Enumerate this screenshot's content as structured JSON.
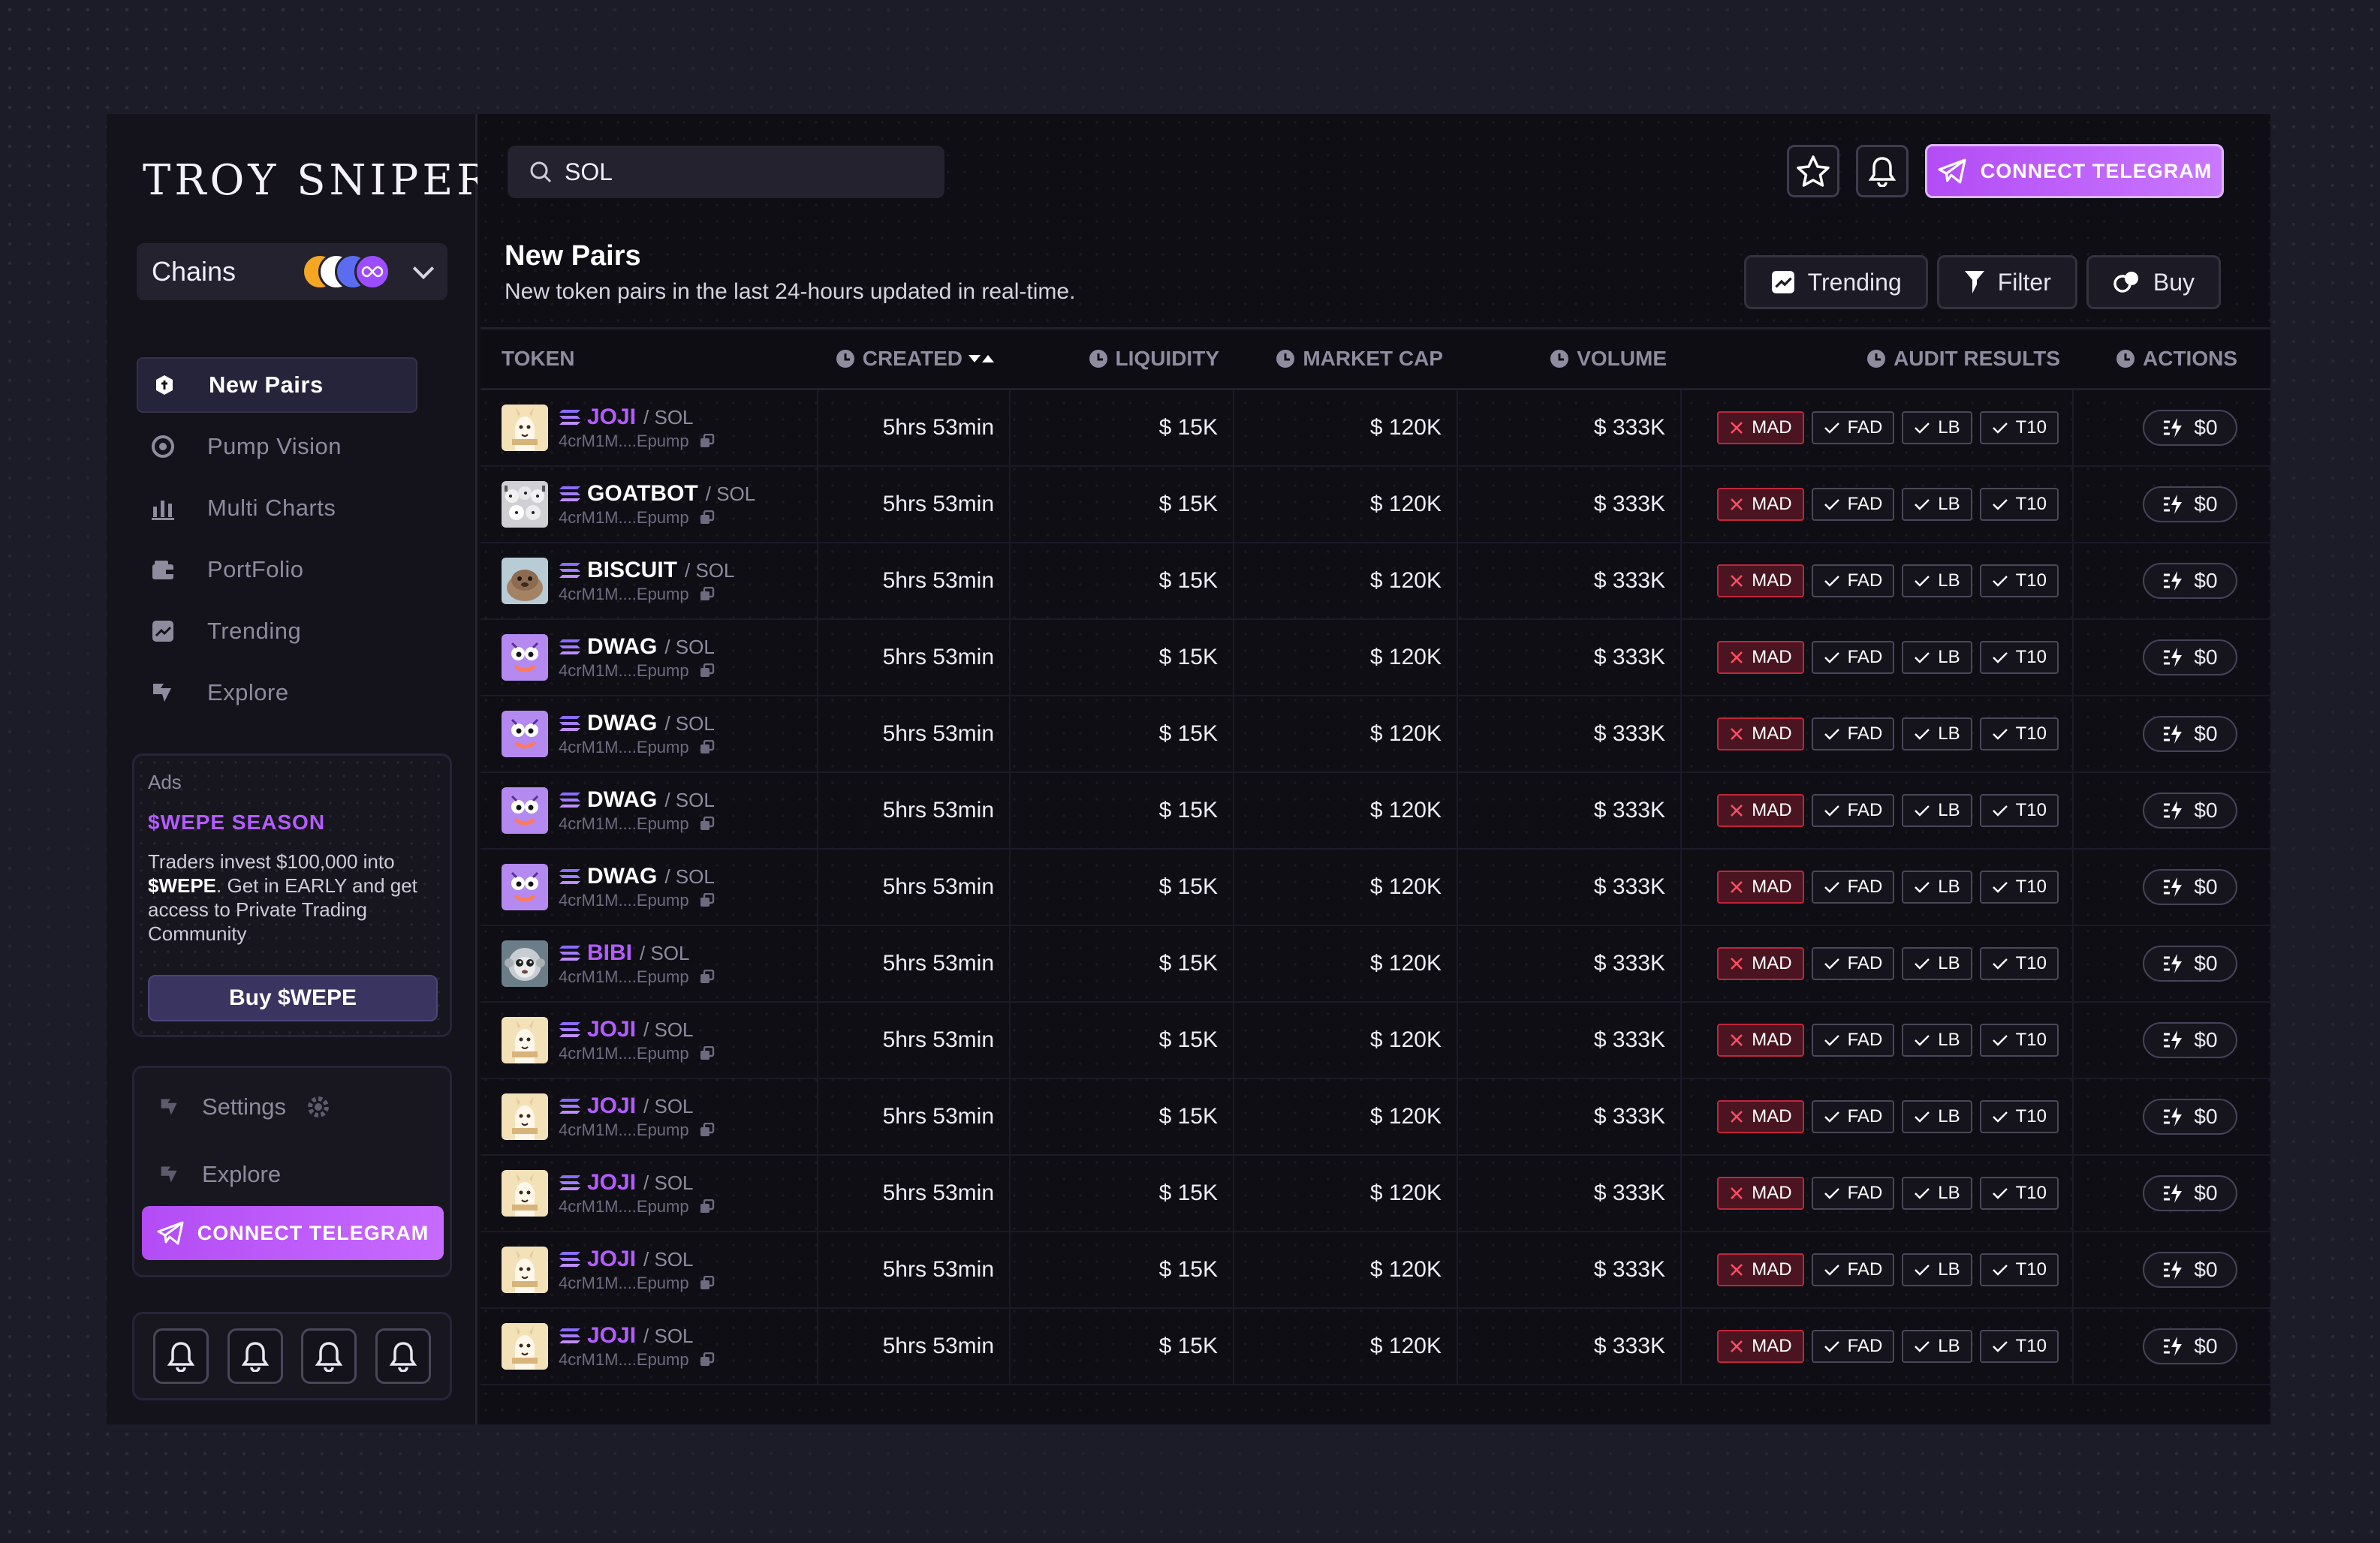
{
  "app": {
    "brand": "TROY SNIPER"
  },
  "chains": {
    "label": "Chains",
    "icon_colors": [
      "#f5a623",
      "#ffffff",
      "#5b6cf0",
      "#9b4dff"
    ]
  },
  "nav": {
    "items": [
      {
        "label": "New Pairs",
        "icon": "new-pairs-icon",
        "active": true
      },
      {
        "label": "Pump Vision",
        "icon": "pump-vision-icon"
      },
      {
        "label": "Multi Charts",
        "icon": "bar-chart-icon"
      },
      {
        "label": "PortFolio",
        "icon": "portfolio-icon"
      },
      {
        "label": "Trending",
        "icon": "trending-icon"
      },
      {
        "label": "Explore",
        "icon": "explore-icon"
      }
    ]
  },
  "ads": {
    "label": "Ads",
    "title": "$WEPE SEASON",
    "text_a": "Traders invest $100,000 into ",
    "text_b": "$WEPE",
    "text_c": ". Get in EARLY and get access to Private Trading Community",
    "button": "Buy $WEPE"
  },
  "bottom_menu": {
    "settings": "Settings",
    "explore": "Explore",
    "telegram": "CONNECT TELEGRAM"
  },
  "header": {
    "search_value": "SOL",
    "telegram_button": "CONNECT TELEGRAM"
  },
  "page": {
    "title": "New Pairs",
    "subtitle": "New token pairs in the last 24-hours updated in real-time.",
    "buttons": {
      "trending": "Trending",
      "filter": "Filter",
      "buy": "Buy"
    }
  },
  "table": {
    "headers": {
      "token": "TOKEN",
      "created": "CREATED",
      "liquidity": "LIQUIDITY",
      "market_cap": "MARKET CAP",
      "volume": "VOLUME",
      "audit": "AUDIT RESULTS",
      "actions": "ACTIONS"
    },
    "rows": [
      {
        "name": "JOJI",
        "pair": "/ SOL",
        "addr": "4crM1M....Epump",
        "created": "5hrs 53min",
        "liquidity": "$ 15K",
        "market_cap": "$ 120K",
        "volume": "$ 333K",
        "audits": [
          "MAD",
          "FAD",
          "LB",
          "T10"
        ],
        "action": "$0",
        "name_color": "#b45cff",
        "avatar": "llama"
      },
      {
        "name": "GOATBOT",
        "pair": "/ SOL",
        "addr": "4crM1M....Epump",
        "created": "5hrs 53min",
        "liquidity": "$ 15K",
        "market_cap": "$ 120K",
        "volume": "$ 333K",
        "audits": [
          "MAD",
          "FAD",
          "LB",
          "T10"
        ],
        "action": "$0",
        "name_color": "#ffffff",
        "avatar": "goat"
      },
      {
        "name": "BISCUIT",
        "pair": "/ SOL",
        "addr": "4crM1M....Epump",
        "created": "5hrs 53min",
        "liquidity": "$ 15K",
        "market_cap": "$ 120K",
        "volume": "$ 333K",
        "audits": [
          "MAD",
          "FAD",
          "LB",
          "T10"
        ],
        "action": "$0",
        "name_color": "#ffffff",
        "avatar": "biscuit"
      },
      {
        "name": "DWAG",
        "pair": "/ SOL",
        "addr": "4crM1M....Epump",
        "created": "5hrs 53min",
        "liquidity": "$ 15K",
        "market_cap": "$ 120K",
        "volume": "$ 333K",
        "audits": [
          "MAD",
          "FAD",
          "LB",
          "T10"
        ],
        "action": "$0",
        "name_color": "#ffffff",
        "avatar": "dwag"
      },
      {
        "name": "DWAG",
        "pair": "/ SOL",
        "addr": "4crM1M....Epump",
        "created": "5hrs 53min",
        "liquidity": "$ 15K",
        "market_cap": "$ 120K",
        "volume": "$ 333K",
        "audits": [
          "MAD",
          "FAD",
          "LB",
          "T10"
        ],
        "action": "$0",
        "name_color": "#ffffff",
        "avatar": "dwag"
      },
      {
        "name": "DWAG",
        "pair": "/ SOL",
        "addr": "4crM1M....Epump",
        "created": "5hrs 53min",
        "liquidity": "$ 15K",
        "market_cap": "$ 120K",
        "volume": "$ 333K",
        "audits": [
          "MAD",
          "FAD",
          "LB",
          "T10"
        ],
        "action": "$0",
        "name_color": "#ffffff",
        "avatar": "dwag"
      },
      {
        "name": "DWAG",
        "pair": "/ SOL",
        "addr": "4crM1M....Epump",
        "created": "5hrs 53min",
        "liquidity": "$ 15K",
        "market_cap": "$ 120K",
        "volume": "$ 333K",
        "audits": [
          "MAD",
          "FAD",
          "LB",
          "T10"
        ],
        "action": "$0",
        "name_color": "#ffffff",
        "avatar": "dwag"
      },
      {
        "name": "BIBI",
        "pair": "/ SOL",
        "addr": "4crM1M....Epump",
        "created": "5hrs 53min",
        "liquidity": "$ 15K",
        "market_cap": "$ 120K",
        "volume": "$ 333K",
        "audits": [
          "MAD",
          "FAD",
          "LB",
          "T10"
        ],
        "action": "$0",
        "name_color": "#b45cff",
        "avatar": "bibi"
      },
      {
        "name": "JOJI",
        "pair": "/ SOL",
        "addr": "4crM1M....Epump",
        "created": "5hrs 53min",
        "liquidity": "$ 15K",
        "market_cap": "$ 120K",
        "volume": "$ 333K",
        "audits": [
          "MAD",
          "FAD",
          "LB",
          "T10"
        ],
        "action": "$0",
        "name_color": "#b45cff",
        "avatar": "llama"
      },
      {
        "name": "JOJI",
        "pair": "/ SOL",
        "addr": "4crM1M....Epump",
        "created": "5hrs 53min",
        "liquidity": "$ 15K",
        "market_cap": "$ 120K",
        "volume": "$ 333K",
        "audits": [
          "MAD",
          "FAD",
          "LB",
          "T10"
        ],
        "action": "$0",
        "name_color": "#b45cff",
        "avatar": "llama"
      },
      {
        "name": "JOJI",
        "pair": "/ SOL",
        "addr": "4crM1M....Epump",
        "created": "5hrs 53min",
        "liquidity": "$ 15K",
        "market_cap": "$ 120K",
        "volume": "$ 333K",
        "audits": [
          "MAD",
          "FAD",
          "LB",
          "T10"
        ],
        "action": "$0",
        "name_color": "#b45cff",
        "avatar": "llama"
      },
      {
        "name": "JOJI",
        "pair": "/ SOL",
        "addr": "4crM1M....Epump",
        "created": "5hrs 53min",
        "liquidity": "$ 15K",
        "market_cap": "$ 120K",
        "volume": "$ 333K",
        "audits": [
          "MAD",
          "FAD",
          "LB",
          "T10"
        ],
        "action": "$0",
        "name_color": "#b45cff",
        "avatar": "llama"
      },
      {
        "name": "JOJI",
        "pair": "/ SOL",
        "addr": "4crM1M....Epump",
        "created": "5hrs 53min",
        "liquidity": "$ 15K",
        "market_cap": "$ 120K",
        "volume": "$ 333K",
        "audits": [
          "MAD",
          "FAD",
          "LB",
          "T10"
        ],
        "action": "$0",
        "name_color": "#b45cff",
        "avatar": "llama"
      }
    ]
  },
  "colors": {
    "accent": "#b34cf5",
    "danger": "#c0263a",
    "panel": "#14131c"
  }
}
